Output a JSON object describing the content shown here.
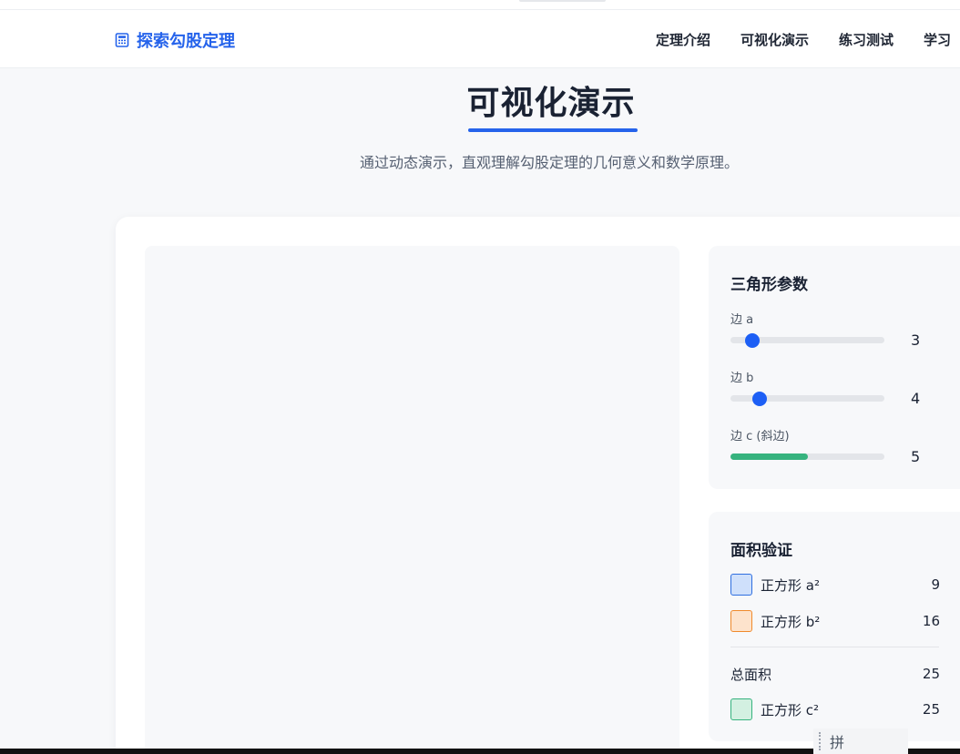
{
  "brand": {
    "icon": "calculator-icon",
    "title": "探索勾股定理"
  },
  "nav": {
    "items": [
      "定理介绍",
      "可视化演示",
      "练习测试",
      "学习"
    ]
  },
  "section": {
    "title": "可视化演示",
    "subtitle": "通过动态演示，直观理解勾股定理的几何意义和数学原理。"
  },
  "params": {
    "title": "三角形参数",
    "sliders": [
      {
        "label": "边 a",
        "value": "3",
        "level": 0.14,
        "color": "#1d5ff5"
      },
      {
        "label": "边 b",
        "value": "4",
        "level": 0.19,
        "color": "#1d5ff5"
      },
      {
        "label": "边 c (斜边)",
        "value": "5",
        "level": 0.5,
        "color": "#36b37e"
      }
    ]
  },
  "area": {
    "title": "面积验证",
    "square_a": {
      "label": "正方形 a²",
      "value": "9",
      "fill": "#cfe0fb",
      "border": "#2f6fe0"
    },
    "square_b": {
      "label": "正方形 b²",
      "value": "16",
      "fill": "#fde3cc",
      "border": "#f08a2c"
    },
    "total": {
      "label": "总面积",
      "value": "25"
    },
    "square_c": {
      "label": "正方形 c²",
      "value": "25",
      "fill": "#d3f0e1",
      "border": "#36b37e"
    }
  },
  "ime": {
    "glyph": "拼"
  }
}
